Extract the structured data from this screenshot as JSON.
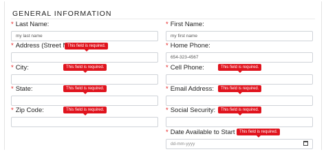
{
  "section": {
    "title": "GENERAL INFORMATION"
  },
  "required_marker": "*",
  "validation_message": "This field is required.",
  "fields": {
    "last_name": {
      "label": "Last Name:",
      "value": "my last name"
    },
    "first_name": {
      "label": "First Name:",
      "value": "my first name"
    },
    "address": {
      "label": "Address (Street Name",
      "value": ""
    },
    "home_phone": {
      "label": "Home Phone:",
      "value": "654-323-4567"
    },
    "city": {
      "label": "City:",
      "value": ""
    },
    "cell_phone": {
      "label": "Cell Phone:",
      "value": ""
    },
    "state": {
      "label": "State:",
      "value": ""
    },
    "email": {
      "label": "Email Address:",
      "value": ""
    },
    "zip_code": {
      "label": "Zip Code:",
      "value": ""
    },
    "social_security": {
      "label": "Social Security:",
      "value": ""
    },
    "date_available": {
      "label": "Date Available to Start",
      "placeholder": "dd-mm-yyyy"
    }
  },
  "icons": {
    "date_picker": "calendar-icon"
  },
  "colors": {
    "error": "#e0141e",
    "required": "#e51b1b",
    "input_border": "#cfd3d8"
  }
}
